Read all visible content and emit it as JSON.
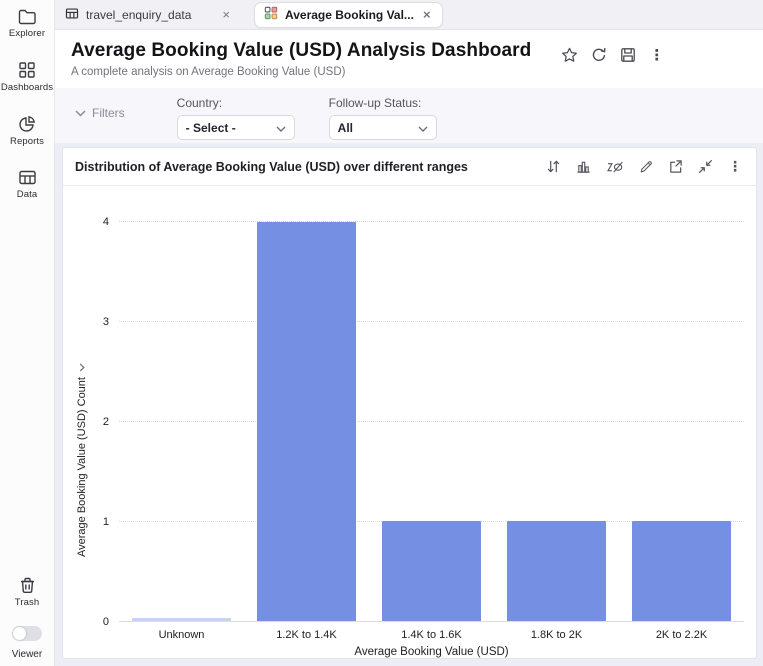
{
  "sidebar": {
    "items": [
      {
        "label": "Explorer"
      },
      {
        "label": "Dashboards"
      },
      {
        "label": "Reports"
      },
      {
        "label": "Data"
      }
    ],
    "trash_label": "Trash",
    "viewer_label": "Viewer"
  },
  "tabs": [
    {
      "label": "travel_enquiry_data"
    },
    {
      "label": "Average Booking Val..."
    }
  ],
  "header": {
    "title": "Average Booking Value (USD) Analysis Dashboard",
    "subtitle": "A complete analysis on Average Booking Value (USD)"
  },
  "filters": {
    "toggle_label": "Filters",
    "country_label": "Country:",
    "country_value": "- Select -",
    "status_label": "Follow-up Status:",
    "status_value": "All"
  },
  "card": {
    "title": "Distribution of Average Booking Value (USD) over different ranges"
  },
  "chart_data": {
    "type": "bar",
    "title": "Distribution of Average Booking Value (USD) over different ranges",
    "categories": [
      "Unknown",
      "1.2K to 1.4K",
      "1.4K to 1.6K",
      "1.8K to 2K",
      "2K to 2.2K"
    ],
    "values": [
      0,
      4,
      1,
      1,
      1
    ],
    "xlabel": "Average Booking Value (USD)",
    "ylabel": "Average Booking Value (USD) Count",
    "ylim": [
      0,
      4
    ],
    "yticks": [
      0,
      1,
      2,
      3,
      4
    ],
    "grid": "horizontal-dotted",
    "legend": "none",
    "bar_color": "#7590E3",
    "zero_bar_color": "#C9D3F1"
  }
}
